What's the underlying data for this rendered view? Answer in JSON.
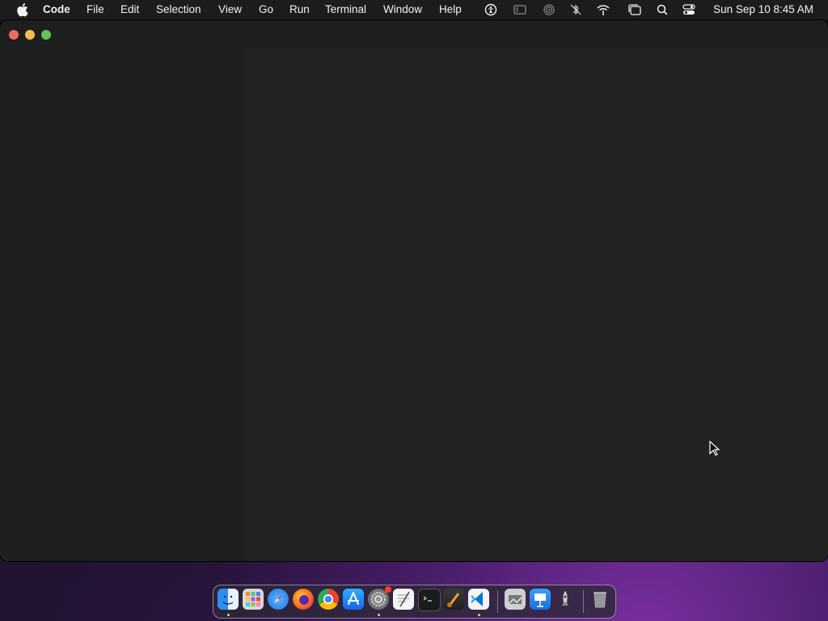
{
  "menubar": {
    "app_name": "Code",
    "menus": [
      "File",
      "Edit",
      "Selection",
      "View",
      "Go",
      "Run",
      "Terminal",
      "Window",
      "Help"
    ],
    "status_icons": [
      "accessibility-icon",
      "screen-mirror-icon",
      "airplay-icon",
      "bluetooth-off-icon",
      "wifi-icon",
      "window-icon",
      "spotlight-search-icon",
      "control-center-icon"
    ],
    "clock": "Sun Sep 10  8:45 AM"
  },
  "window": {
    "title": "",
    "colors": {
      "editor_bg": "#222222",
      "sidebar_bg": "#1f1f1f",
      "close": "#ed6a5e",
      "minimize": "#f5bf4f",
      "zoom": "#61c554"
    }
  },
  "dock": {
    "apps": [
      {
        "name": "finder-icon",
        "running": true
      },
      {
        "name": "launchpad-icon",
        "running": false
      },
      {
        "name": "safari-icon",
        "running": false
      },
      {
        "name": "firefox-icon",
        "running": false
      },
      {
        "name": "chrome-icon",
        "running": false
      },
      {
        "name": "app-store-icon",
        "running": false
      },
      {
        "name": "system-settings-icon",
        "running": true,
        "badge": true
      },
      {
        "name": "textedit-icon",
        "running": false
      },
      {
        "name": "terminal-icon",
        "running": false
      },
      {
        "name": "instruments-icon",
        "running": false
      },
      {
        "name": "vscode-icon",
        "running": true
      },
      {
        "name": "preview-icon",
        "running": false
      },
      {
        "name": "keynote-icon",
        "running": false
      },
      {
        "name": "rocket-icon",
        "running": false
      },
      {
        "name": "trash-icon",
        "running": false
      }
    ]
  }
}
